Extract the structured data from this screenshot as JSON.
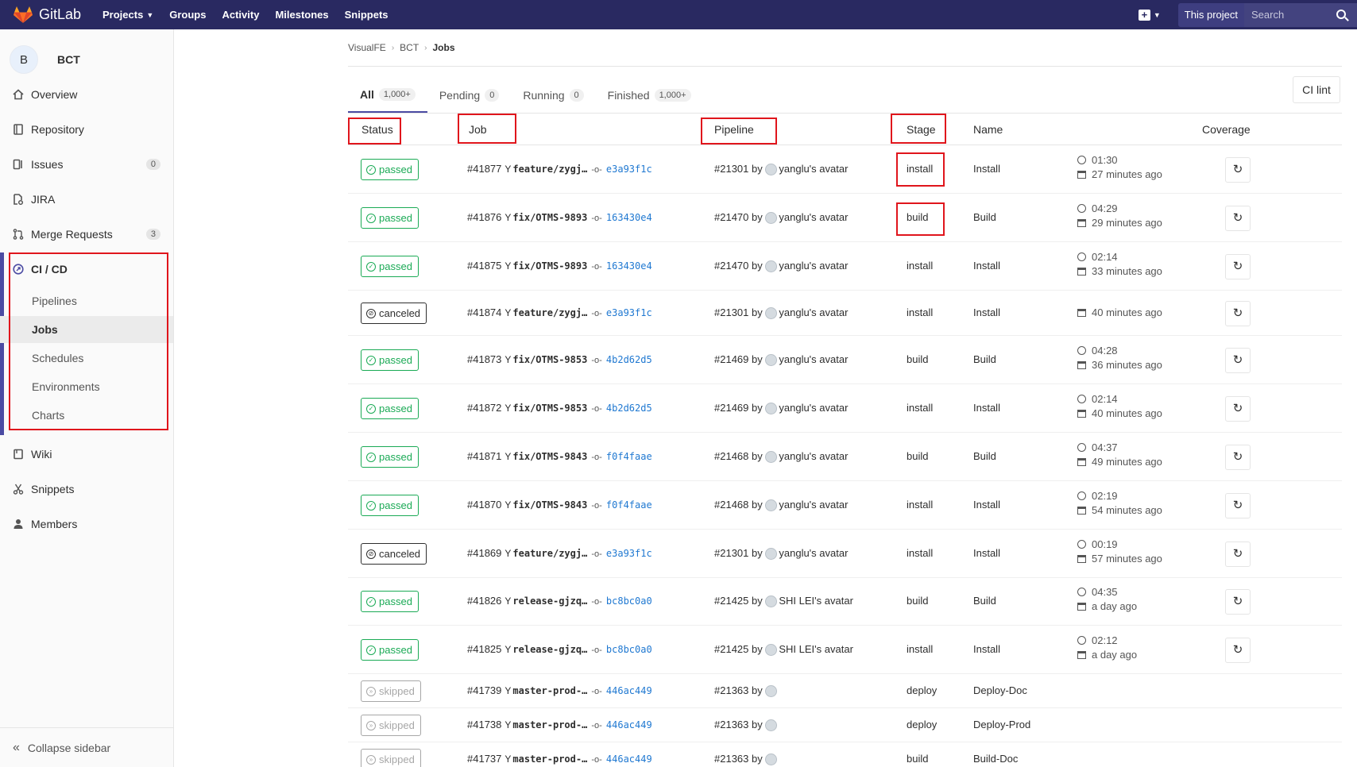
{
  "topbar": {
    "app_name": "GitLab",
    "nav": [
      "Projects",
      "Groups",
      "Activity",
      "Milestones",
      "Snippets"
    ],
    "this_project": "This project",
    "search_placeholder": "Search",
    "bg_color": "#292961"
  },
  "sidebar": {
    "avatar_letter": "B",
    "project_name": "BCT",
    "items": [
      {
        "label": "Overview",
        "icon": "home-icon"
      },
      {
        "label": "Repository",
        "icon": "book-icon"
      },
      {
        "label": "Issues",
        "icon": "issues-icon",
        "count": "0"
      },
      {
        "label": "JIRA",
        "icon": "jira-icon"
      },
      {
        "label": "Merge Requests",
        "icon": "merge-request-icon",
        "count": "3"
      },
      {
        "label": "CI / CD",
        "icon": "rocket-icon"
      },
      {
        "label": "Wiki",
        "icon": "wiki-icon"
      },
      {
        "label": "Snippets",
        "icon": "scissors-icon"
      },
      {
        "label": "Members",
        "icon": "user-icon"
      }
    ],
    "cicd_sub": [
      "Pipelines",
      "Jobs",
      "Schedules",
      "Environments",
      "Charts"
    ],
    "collapse": "Collapse sidebar"
  },
  "breadcrumb": [
    "VisualFE",
    "BCT",
    "Jobs"
  ],
  "tabs": [
    {
      "label": "All",
      "count": "1,000+"
    },
    {
      "label": "Pending",
      "count": "0"
    },
    {
      "label": "Running",
      "count": "0"
    },
    {
      "label": "Finished",
      "count": "1,000+"
    }
  ],
  "ci_lint": "CI lint",
  "columns": [
    "Status",
    "Job",
    "Pipeline",
    "Stage",
    "Name",
    "Coverage"
  ],
  "rows": [
    {
      "status": "passed",
      "job": "#41877",
      "branch": "feature/zygj…",
      "sha": "e3a93f1c",
      "pipeline": "#21301",
      "by": "by",
      "user": "yanglu's avatar",
      "stage": "install",
      "name": "Install",
      "duration": "01:30",
      "finished": "27 minutes ago"
    },
    {
      "status": "passed",
      "job": "#41876",
      "branch": "fix/OTMS-9893",
      "sha": "163430e4",
      "pipeline": "#21470",
      "by": "by",
      "user": "yanglu's avatar",
      "stage": "build",
      "name": "Build",
      "duration": "04:29",
      "finished": "29 minutes ago"
    },
    {
      "status": "passed",
      "job": "#41875",
      "branch": "fix/OTMS-9893",
      "sha": "163430e4",
      "pipeline": "#21470",
      "by": "by",
      "user": "yanglu's avatar",
      "stage": "install",
      "name": "Install",
      "duration": "02:14",
      "finished": "33 minutes ago"
    },
    {
      "status": "canceled",
      "job": "#41874",
      "branch": "feature/zygj…",
      "sha": "e3a93f1c",
      "pipeline": "#21301",
      "by": "by",
      "user": "yanglu's avatar",
      "stage": "install",
      "name": "Install",
      "duration": "",
      "finished": "40 minutes ago"
    },
    {
      "status": "passed",
      "job": "#41873",
      "branch": "fix/OTMS-9853",
      "sha": "4b2d62d5",
      "pipeline": "#21469",
      "by": "by",
      "user": "yanglu's avatar",
      "stage": "build",
      "name": "Build",
      "duration": "04:28",
      "finished": "36 minutes ago"
    },
    {
      "status": "passed",
      "job": "#41872",
      "branch": "fix/OTMS-9853",
      "sha": "4b2d62d5",
      "pipeline": "#21469",
      "by": "by",
      "user": "yanglu's avatar",
      "stage": "install",
      "name": "Install",
      "duration": "02:14",
      "finished": "40 minutes ago"
    },
    {
      "status": "passed",
      "job": "#41871",
      "branch": "fix/OTMS-9843",
      "sha": "f0f4faae",
      "pipeline": "#21468",
      "by": "by",
      "user": "yanglu's avatar",
      "stage": "build",
      "name": "Build",
      "duration": "04:37",
      "finished": "49 minutes ago"
    },
    {
      "status": "passed",
      "job": "#41870",
      "branch": "fix/OTMS-9843",
      "sha": "f0f4faae",
      "pipeline": "#21468",
      "by": "by",
      "user": "yanglu's avatar",
      "stage": "install",
      "name": "Install",
      "duration": "02:19",
      "finished": "54 minutes ago"
    },
    {
      "status": "canceled",
      "job": "#41869",
      "branch": "feature/zygj…",
      "sha": "e3a93f1c",
      "pipeline": "#21301",
      "by": "by",
      "user": "yanglu's avatar",
      "stage": "install",
      "name": "Install",
      "duration": "00:19",
      "finished": "57 minutes ago"
    },
    {
      "status": "passed",
      "job": "#41826",
      "branch": "release-gjzq…",
      "sha": "bc8bc0a0",
      "pipeline": "#21425",
      "by": "by",
      "user": "SHI LEI's avatar",
      "stage": "build",
      "name": "Build",
      "duration": "04:35",
      "finished": "a day ago"
    },
    {
      "status": "passed",
      "job": "#41825",
      "branch": "release-gjzq…",
      "sha": "bc8bc0a0",
      "pipeline": "#21425",
      "by": "by",
      "user": "SHI LEI's avatar",
      "stage": "install",
      "name": "Install",
      "duration": "02:12",
      "finished": "a day ago"
    },
    {
      "status": "skipped",
      "job": "#41739",
      "branch": "master-prod-…",
      "sha": "446ac449",
      "pipeline": "#21363",
      "by": "by",
      "user": "",
      "stage": "deploy",
      "name": "Deploy-Doc",
      "duration": "",
      "finished": ""
    },
    {
      "status": "skipped",
      "job": "#41738",
      "branch": "master-prod-…",
      "sha": "446ac449",
      "pipeline": "#21363",
      "by": "by",
      "user": "",
      "stage": "deploy",
      "name": "Deploy-Prod",
      "duration": "",
      "finished": ""
    },
    {
      "status": "skipped",
      "job": "#41737",
      "branch": "master-prod-…",
      "sha": "446ac449",
      "pipeline": "#21363",
      "by": "by",
      "user": "",
      "stage": "build",
      "name": "Build-Doc",
      "duration": "",
      "finished": ""
    }
  ],
  "colors": {
    "accent": "#4b4ba3",
    "passed": "#1aaa55",
    "link": "#1f78d1",
    "annotation": "#e0151c"
  }
}
